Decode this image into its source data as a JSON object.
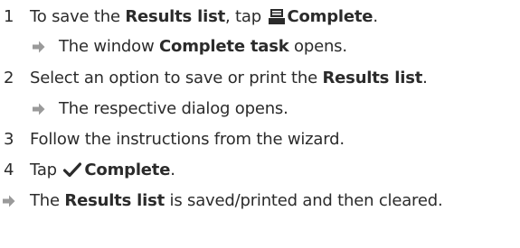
{
  "steps": [
    {
      "number": "1",
      "parts": {
        "a": "To save the ",
        "b_results": "Results list",
        "c": ", tap ",
        "d_complete": "Complete",
        "e": "."
      },
      "icon": "printer-icon",
      "result": {
        "a": "The window ",
        "b": "Complete task",
        "c": " opens."
      }
    },
    {
      "number": "2",
      "parts": {
        "a": "Select an option to save or print the ",
        "b": "Results list",
        "c": "."
      },
      "result": {
        "a": "The respective dialog opens."
      }
    },
    {
      "number": "3",
      "parts": {
        "a": "Follow the instructions from the wizard."
      }
    },
    {
      "number": "4",
      "parts": {
        "a": "Tap ",
        "b": "Complete",
        "c": "."
      },
      "icon": "checkmark-icon"
    }
  ],
  "final_result": {
    "a": "The ",
    "b": "Results list",
    "c": " is saved/printed and then cleared."
  },
  "colors": {
    "text": "#2b2b2b",
    "arrow": "#9a9a9a"
  }
}
